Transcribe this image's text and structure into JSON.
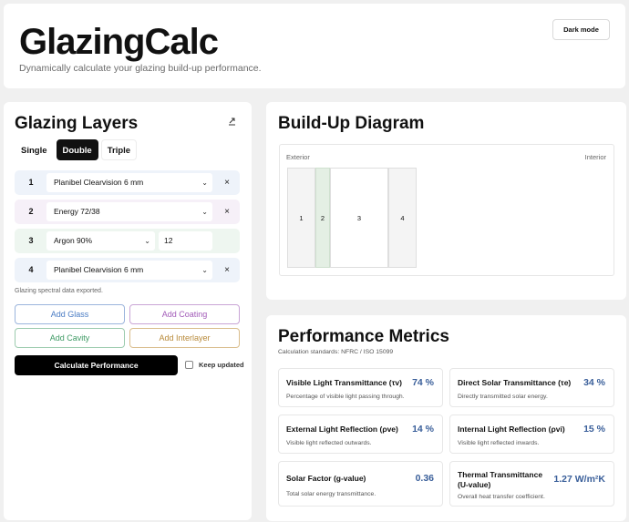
{
  "header": {
    "title": "GlazingCalc",
    "subtitle": "Dynamically calculate your glazing build-up performance.",
    "dark_mode_label": "Dark mode"
  },
  "layers_panel": {
    "title": "Glazing Layers",
    "export_icon": "export-icon",
    "tabs": [
      {
        "label": "Single",
        "active": false
      },
      {
        "label": "Double",
        "active": true
      },
      {
        "label": "Triple",
        "active": false
      }
    ],
    "layers": [
      {
        "number": "1",
        "value": "Planibel Clearvision 6 mm",
        "type": "glass",
        "color": "#eef3fa"
      },
      {
        "number": "2",
        "value": "Energy 72/38",
        "type": "coating",
        "color": "#f6f0f8"
      },
      {
        "number": "3",
        "value": "Argon 90%",
        "thickness": "12",
        "type": "cavity",
        "color": "#eef6f0"
      },
      {
        "number": "4",
        "value": "Planibel Clearvision 6 mm",
        "type": "glass",
        "color": "#eef3fa"
      }
    ],
    "remove_symbol": "×",
    "export_note": "Glazing spectral data exported.",
    "add_glass": "Add Glass",
    "add_coating": "Add Coating",
    "add_cavity": "Add Cavity",
    "add_interlayer": "Add Interlayer",
    "calculate": "Calculate Performance",
    "keep_updated": "Keep updated",
    "colors": {
      "glass": "#4a7cc4",
      "coating": "#a25bb8",
      "cavity": "#3e9a64",
      "interlayer": "#b88a3a"
    }
  },
  "diagram": {
    "title": "Build-Up Diagram",
    "exterior": "Exterior",
    "interior": "Interior",
    "panes": [
      "1",
      "2",
      "3",
      "4"
    ]
  },
  "metrics": {
    "title": "Performance Metrics",
    "subtitle": "Calculation standards: NFRC / ISO 15099",
    "items": [
      {
        "name": "Visible Light Transmittance (τv)",
        "value": "74 %",
        "desc": "Percentage of visible light passing through."
      },
      {
        "name": "Direct Solar Transmittance (τe)",
        "value": "34 %",
        "desc": "Directly transmitted solar energy."
      },
      {
        "name": "External Light Reflection (ρve)",
        "value": "14 %",
        "desc": "Visible light reflected outwards."
      },
      {
        "name": "Internal Light Reflection (ρvi)",
        "value": "15 %",
        "desc": "Visible light reflected inwards."
      },
      {
        "name": "Solar Factor (g-value)",
        "value": "0.36",
        "desc": "Total solar energy transmittance."
      },
      {
        "name": "Thermal Transmittance (U-value)",
        "value": "1.27 W/m²K",
        "desc": "Overall heat transfer coefficient."
      }
    ]
  }
}
